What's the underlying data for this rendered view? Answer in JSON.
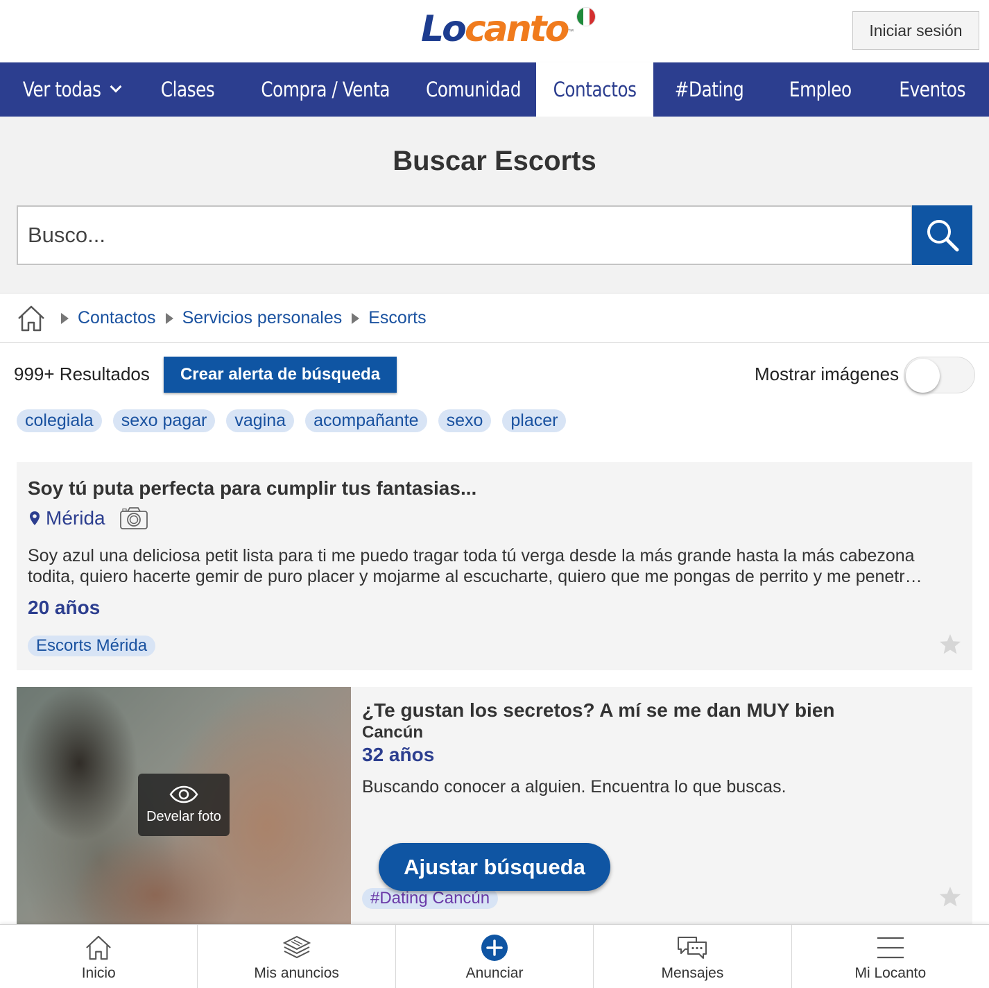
{
  "header": {
    "logo": "Locanto",
    "login_label": "Iniciar sesión"
  },
  "nav": {
    "items": [
      {
        "label": "Ver todas"
      },
      {
        "label": "Clases"
      },
      {
        "label": "Compra / Venta"
      },
      {
        "label": "Comunidad"
      },
      {
        "label": "Contactos",
        "active": true
      },
      {
        "label": "#Dating"
      },
      {
        "label": "Empleo"
      },
      {
        "label": "Eventos"
      }
    ]
  },
  "search": {
    "title": "Buscar Escorts",
    "placeholder": "Busco...",
    "icon": "search-icon"
  },
  "breadcrumb": {
    "home_icon": "home-icon",
    "items": [
      "Contactos",
      "Servicios personales",
      "Escorts"
    ]
  },
  "results": {
    "count": "999+ Resultados",
    "alert_button": "Crear alerta de búsqueda",
    "show_images_label": "Mostrar imágenes",
    "show_images_on": false
  },
  "tags": [
    "colegiala",
    "sexo pagar",
    "vagina",
    "acompañante",
    "sexo",
    "placer"
  ],
  "listings": [
    {
      "title": "Soy tú puta perfecta para cumplir tus fantasias...",
      "city": "Mérida",
      "description": "Soy azul una deliciosa petit lista para ti me puedo tragar toda tú verga desde la más grande hasta la más cabezona todita, quiero hacerte gemir de puro placer y mojarme al escucharte, quiero que me pongas de perrito y me penetr…",
      "age": "20 años",
      "tag": "Escorts Mérida"
    },
    {
      "title": "¿Te gustan los secretos? A mí se me dan MUY bien",
      "city": "Cancún",
      "age": "32 años",
      "description": "Buscando conocer a alguien. Encuentra lo que buscas.",
      "tag": "#Dating Cancún",
      "reveal_label": "Develar foto"
    }
  ],
  "adjust_button": "Ajustar búsqueda",
  "bottom_bar": {
    "items": [
      {
        "label": "Inicio",
        "icon": "home-icon"
      },
      {
        "label": "Mis anuncios",
        "icon": "layers-icon"
      },
      {
        "label": "Anunciar",
        "icon": "plus-circle-icon"
      },
      {
        "label": "Mensajes",
        "icon": "chat-icon"
      },
      {
        "label": "Mi Locanto",
        "icon": "menu-icon"
      }
    ]
  },
  "colors": {
    "nav_bg": "#2c3e8f",
    "primary_button": "#0f55a3",
    "tag_bg": "#d8e4f5",
    "link": "#1a52a0"
  }
}
